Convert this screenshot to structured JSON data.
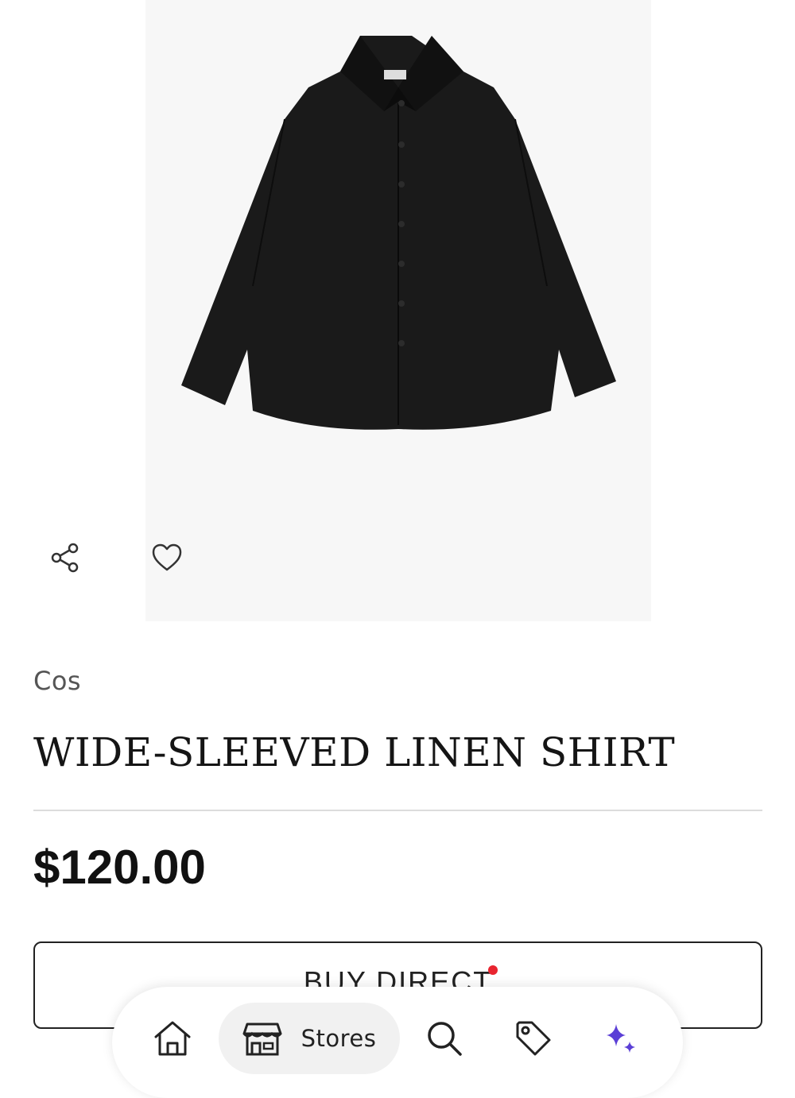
{
  "product": {
    "image_alt": "black wide-sleeved linen shirt",
    "brand": "Cos",
    "title": "WIDE-SLEEVED LINEN SHIRT",
    "price": "$120.00"
  },
  "actions": {
    "share_icon": "share-icon",
    "favorite_icon": "heart-icon",
    "buy_label": "BUY DIRECT",
    "buy_indicator_color": "#e8242f"
  },
  "bottom_nav": {
    "items": [
      {
        "icon": "home-icon",
        "label": ""
      },
      {
        "icon": "store-icon",
        "label": "Stores"
      },
      {
        "icon": "search-icon",
        "label": ""
      },
      {
        "icon": "tag-icon",
        "label": ""
      },
      {
        "icon": "sparkle-icon",
        "label": ""
      }
    ],
    "accent": "#5b3fd6"
  }
}
